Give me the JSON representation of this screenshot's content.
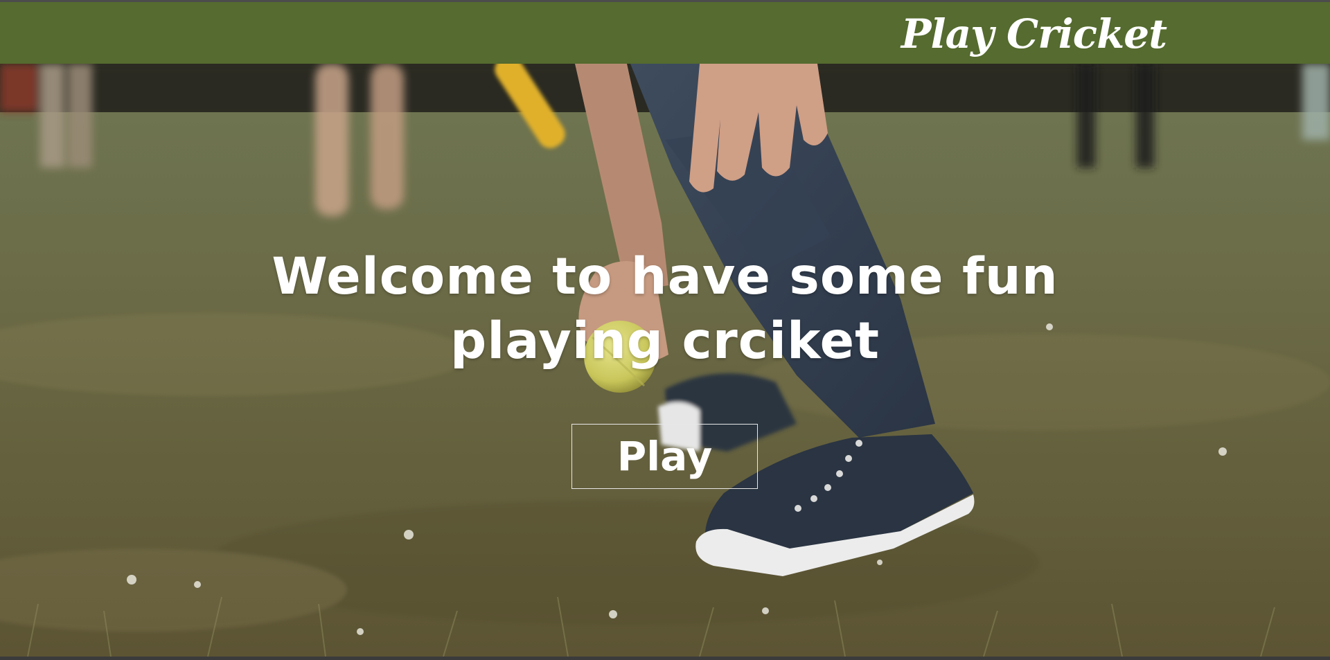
{
  "header": {
    "brand": "Play Cricket",
    "background_color": "#556b2f"
  },
  "hero": {
    "headline": "Welcome to have some fun playing crciket",
    "play_button_label": "Play",
    "background_image": "person picking up a yellow cricket ball on a grassy field"
  }
}
